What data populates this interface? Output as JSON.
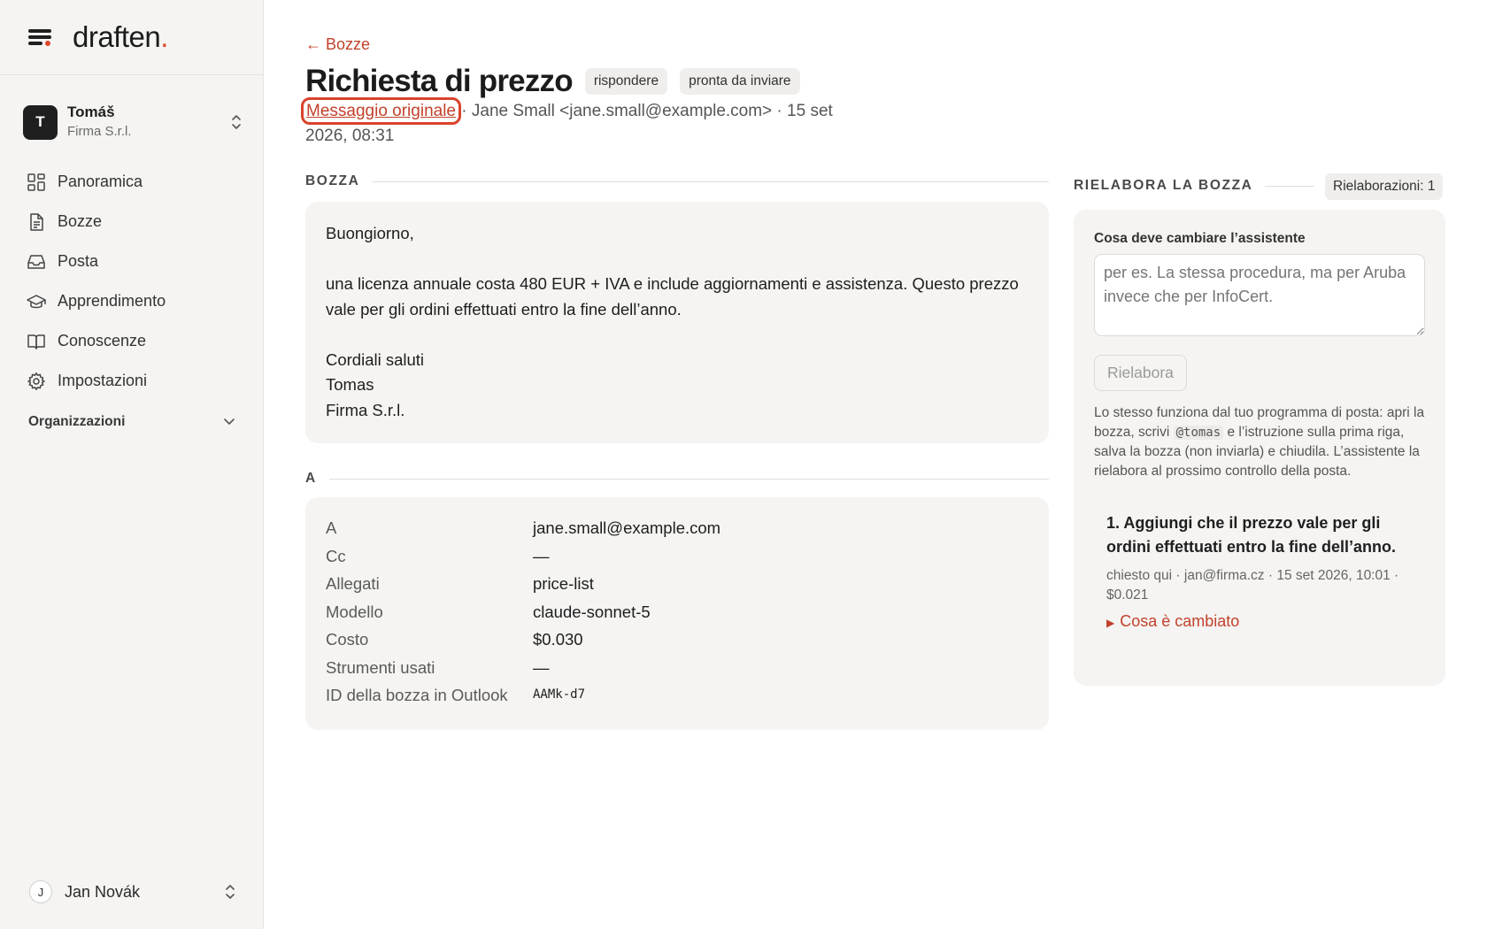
{
  "brand": {
    "name": "draften",
    "dot": "."
  },
  "account": {
    "initial": "T",
    "name": "Tomáš",
    "org": "Firma S.r.l."
  },
  "nav": {
    "items": [
      {
        "label": "Panoramica",
        "icon": "dashboard-icon"
      },
      {
        "label": "Bozze",
        "icon": "document-icon"
      },
      {
        "label": "Posta",
        "icon": "inbox-icon"
      },
      {
        "label": "Apprendimento",
        "icon": "graduation-cap-icon"
      },
      {
        "label": "Conoscenze",
        "icon": "book-icon"
      },
      {
        "label": "Impostazioni",
        "icon": "gear-icon"
      }
    ]
  },
  "organizations": {
    "label": "Organizzazioni"
  },
  "user": {
    "initial": "J",
    "name": "Jan Novák"
  },
  "header": {
    "back_label": "← Bozze",
    "title": "Richiesta di prezzo",
    "badges": [
      "rispondere",
      "pronta da inviare"
    ],
    "original_link": "Messaggio originale",
    "meta": " · Jane Small <jane.small@example.com> · 15 set 2026, 08:31"
  },
  "draft": {
    "section_label": "BOZZA",
    "greeting": "Buongiorno,",
    "body": "una licenza annuale costa 480 EUR + IVA e include aggiornamenti e assistenza. Questo prezzo vale per gli ordini effettuati entro la fine dell’anno.",
    "closing": "Cordiali saluti",
    "signature_name": "Tomas",
    "signature_org": "Firma S.r.l."
  },
  "details": {
    "section_label": "A",
    "rows": [
      {
        "key": "A",
        "value": "jane.small@example.com"
      },
      {
        "key": "Cc",
        "value": "—"
      },
      {
        "key": "Allegati",
        "value": "price-list"
      },
      {
        "key": "Modello",
        "value": "claude-sonnet-5"
      },
      {
        "key": "Costo",
        "value": "$0.030"
      },
      {
        "key": "Strumenti usati",
        "value": "—"
      },
      {
        "key": "ID della bozza in Outlook",
        "value": "AAMk-d7"
      }
    ]
  },
  "rework": {
    "section_label": "RIELABORA LA BOZZA",
    "count_badge": "Rielaborazioni: 1",
    "field_label": "Cosa deve cambiare l’assistente",
    "placeholder": "per es. La stessa procedura, ma per Aruba invece che per InfoCert.",
    "button_label": "Rielabora",
    "help_1": "Lo stesso funziona dal tuo programma di posta: apri la bozza, scrivi ",
    "help_code": "@tomas",
    "help_2": " e l’istruzione sulla prima riga, salva la bozza (non inviarla) e chiudila. L’assistente la rielabora al prossimo controllo della posta.",
    "request": {
      "title": "1. Aggiungi che il prezzo vale per gli ordini effettuati entro la fine dell’anno.",
      "meta": "chiesto qui · jan@firma.cz · 15 set 2026, 10:01 · $0.021",
      "toggle_label": "Cosa è cambiato"
    }
  },
  "colors": {
    "accent": "#c2412b",
    "brand_dot": "#e0452b",
    "panel": "#f5f4f2"
  }
}
